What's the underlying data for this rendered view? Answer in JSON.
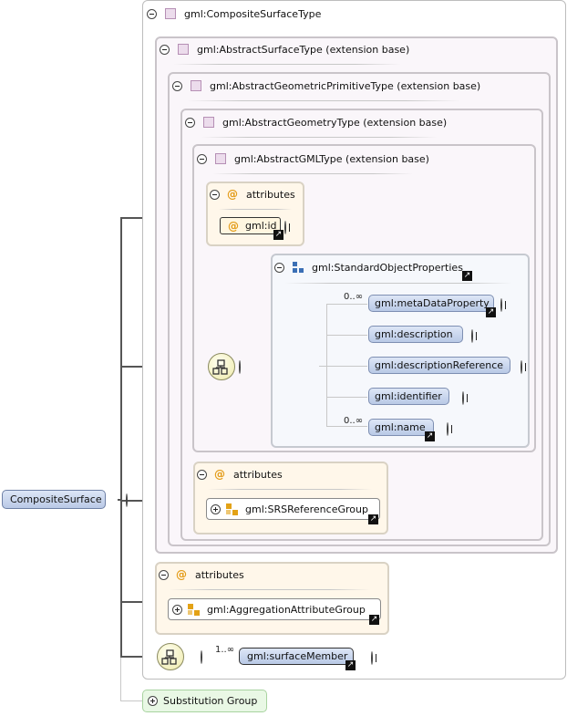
{
  "root": {
    "label": "CompositeSurface"
  },
  "types": [
    {
      "label": "gml:CompositeSurfaceType"
    },
    {
      "label": "gml:AbstractSurfaceType (extension base)"
    },
    {
      "label": "gml:AbstractGeometricPrimitiveType (extension base)"
    },
    {
      "label": "gml:AbstractGeometryType (extension base)"
    },
    {
      "label": "gml:AbstractGMLType (extension base)"
    }
  ],
  "attributes_label": "attributes",
  "attr_symbol": "@",
  "gml_id": "gml:id",
  "standard_object_properties": {
    "label": "gml:StandardObjectProperties",
    "elements": [
      {
        "label": "gml:metaDataProperty",
        "occurrence": "0..∞"
      },
      {
        "label": "gml:description",
        "occurrence": ""
      },
      {
        "label": "gml:descriptionReference",
        "occurrence": ""
      },
      {
        "label": "gml:identifier",
        "occurrence": ""
      },
      {
        "label": "gml:name",
        "occurrence": "0..∞"
      }
    ]
  },
  "srs_group": "gml:SRSReferenceGroup",
  "aggregation_group": "gml:AggregationAttributeGroup",
  "surface_member": {
    "label": "gml:surfaceMember",
    "occurrence": "1..∞"
  },
  "substitution_group": "Substitution Group",
  "link_glyph": "↗"
}
